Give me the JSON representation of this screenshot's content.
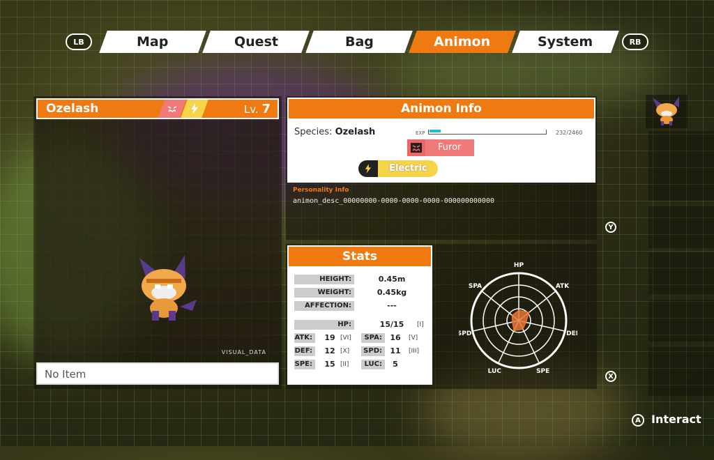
{
  "tabs": {
    "left_bumper": "LB",
    "right_bumper": "RB",
    "items": [
      "Map",
      "Quest",
      "Bag",
      "Animon",
      "System"
    ],
    "active_index": 3
  },
  "animon": {
    "name": "Ozelash",
    "level_prefix": "Lv.",
    "level": "7",
    "visual_data_label": "VISUAL_DATA",
    "held_item": "No Item"
  },
  "info": {
    "title": "Animon Info",
    "species_label": "Species:",
    "species": "Ozelash",
    "exp_label": "EXP",
    "exp_value": "232/2460",
    "exp_fraction": 0.094,
    "trait": "Furor",
    "element": "Electric",
    "personality_label": "Personality Info",
    "personality_text": "animon_desc_00000000-0000-0000-0000-000000000000"
  },
  "stats": {
    "title": "Stats",
    "height_label": "HEIGHT:",
    "height": "0.45m",
    "weight_label": "WEIGHT:",
    "weight": "0.45kg",
    "affection_label": "AFFECTION:",
    "affection": "---",
    "hp_label": "HP:",
    "hp": "15/15",
    "hp_rank": "[I]",
    "atk_label": "ATK:",
    "atk": "19",
    "atk_rank": "[VI]",
    "spa_label": "SPA:",
    "spa": "16",
    "spa_rank": "[V]",
    "def_label": "DEF:",
    "def": "12",
    "def_rank": "[X]",
    "spd_label": "SPD:",
    "spd": "11",
    "spd_rank": "[III]",
    "spe_label": "SPE:",
    "spe": "15",
    "spe_rank": "[II]",
    "luc_label": "LUC:",
    "luc": "5"
  },
  "radar": {
    "axes": [
      "HP",
      "ATK",
      "DEF",
      "SPE",
      "LUC",
      "SPD",
      "SPA"
    ],
    "values": [
      0.22,
      0.28,
      0.16,
      0.2,
      0.24,
      0.14,
      0.18
    ]
  },
  "buttons": {
    "y": "Y",
    "x": "X",
    "a": "A",
    "interact": "Interact"
  },
  "colors": {
    "accent": "#f07a12",
    "exp_bar": "#29b6d8",
    "electric": "#f6d449",
    "furor": "#f07a7a"
  }
}
